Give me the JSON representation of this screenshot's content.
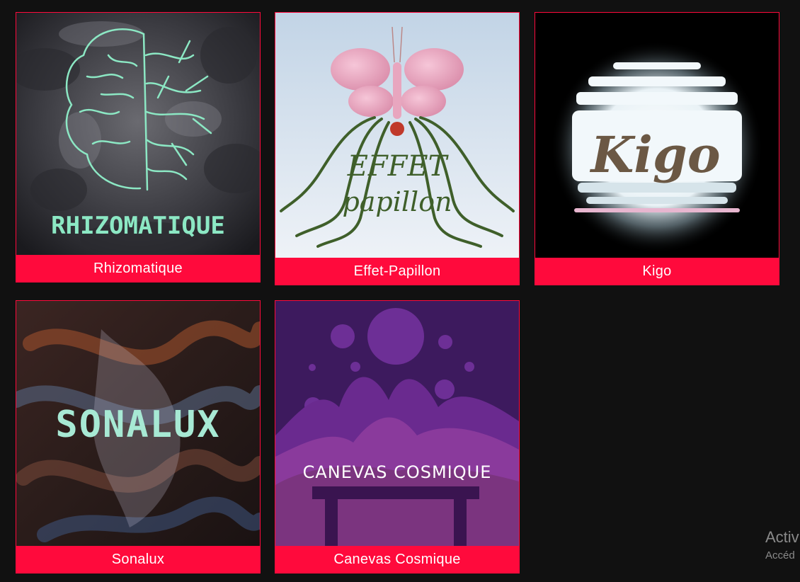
{
  "projects": [
    {
      "title": "Rhizomatique",
      "art_text": "RHIZOMATIQUE"
    },
    {
      "title": "Effet-Papillon",
      "art_text_1": "EFFET",
      "art_text_2": "papillon"
    },
    {
      "title": "Kigo",
      "art_text": "Kigo"
    },
    {
      "title": "Sonalux",
      "art_text": "SONALUX"
    },
    {
      "title": "Canevas Cosmique",
      "art_text": "CANEVAS COSMIQUE"
    }
  ],
  "watermark": {
    "line1": "Activ",
    "line2": "Accéd"
  },
  "colors": {
    "background": "#111111",
    "accent": "#ff0a3c",
    "label_text": "#ffffff"
  }
}
